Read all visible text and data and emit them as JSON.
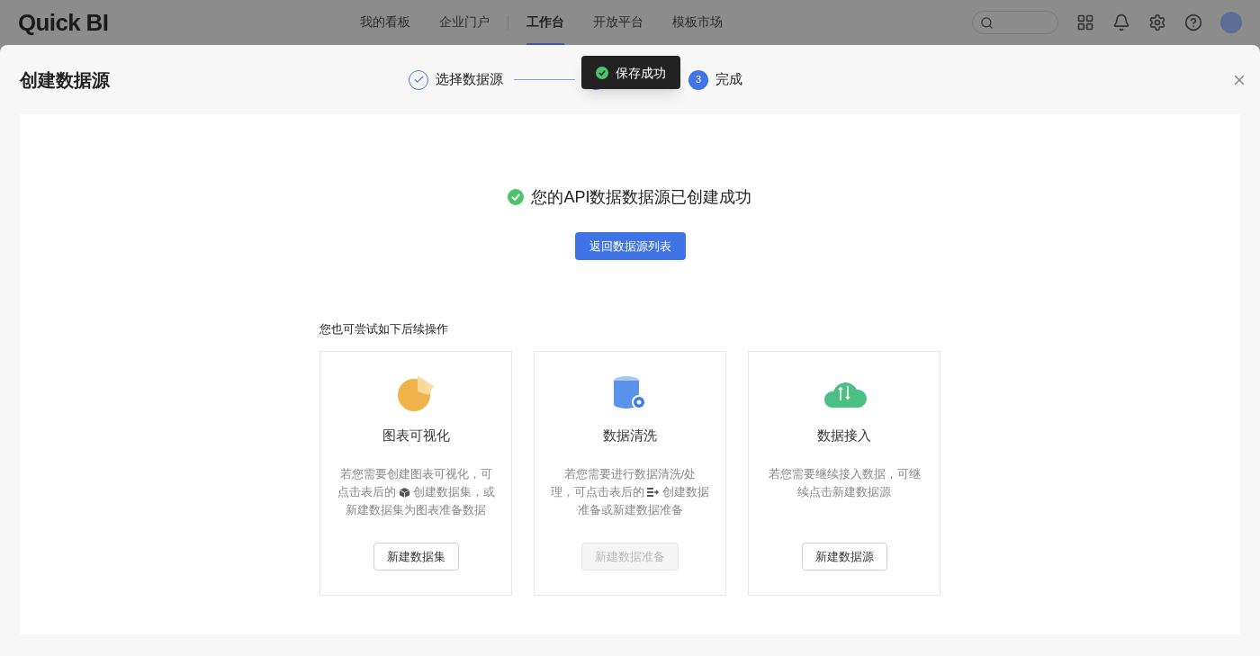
{
  "header": {
    "logo": "Quick BI",
    "nav": [
      {
        "label": "我的看板",
        "selected": false
      },
      {
        "label": "企业门户",
        "selected": false
      },
      {
        "label": "工作台",
        "selected": true
      },
      {
        "label": "开放平台",
        "selected": false
      },
      {
        "label": "模板市场",
        "selected": false
      }
    ]
  },
  "modal": {
    "title": "创建数据源",
    "steps": [
      {
        "label": "选择数据源",
        "done": true
      },
      {
        "done": true
      },
      {
        "label": "完成",
        "done": false,
        "number": "3"
      }
    ]
  },
  "toast": {
    "text": "保存成功"
  },
  "result": {
    "message": "您的API数据数据源已创建成功",
    "button": "返回数据源列表"
  },
  "next": {
    "heading": "您也可尝试如下后续操作",
    "cards": [
      {
        "kind": "chart",
        "title": "图表可视化",
        "lines": [
          {
            "kind": "plain",
            "text": "若您需要创建图表可视化，可"
          },
          {
            "kind": "cube",
            "before": "点击表后的",
            "after": "创建数据集，或"
          },
          {
            "kind": "plain",
            "text": "新建数据集为图表准备数据"
          }
        ],
        "button": "新建数据集",
        "disabled": false
      },
      {
        "kind": "database",
        "title": "数据清洗",
        "lines": [
          {
            "kind": "plain",
            "text": "若您需要进行数据清洗/处"
          },
          {
            "kind": "flow",
            "before": "理，可点击表后的",
            "after": "创建数据"
          },
          {
            "kind": "plain",
            "text": "准备或新建数据准备"
          }
        ],
        "button": "新建数据准备",
        "disabled": true
      },
      {
        "kind": "cloud",
        "title": "数据接入",
        "lines": [
          {
            "kind": "plain",
            "text": "若您需要继续接入数据，可继"
          },
          {
            "kind": "plain",
            "text": "续点击新建数据源"
          }
        ],
        "button": "新建数据源",
        "disabled": false
      }
    ]
  }
}
